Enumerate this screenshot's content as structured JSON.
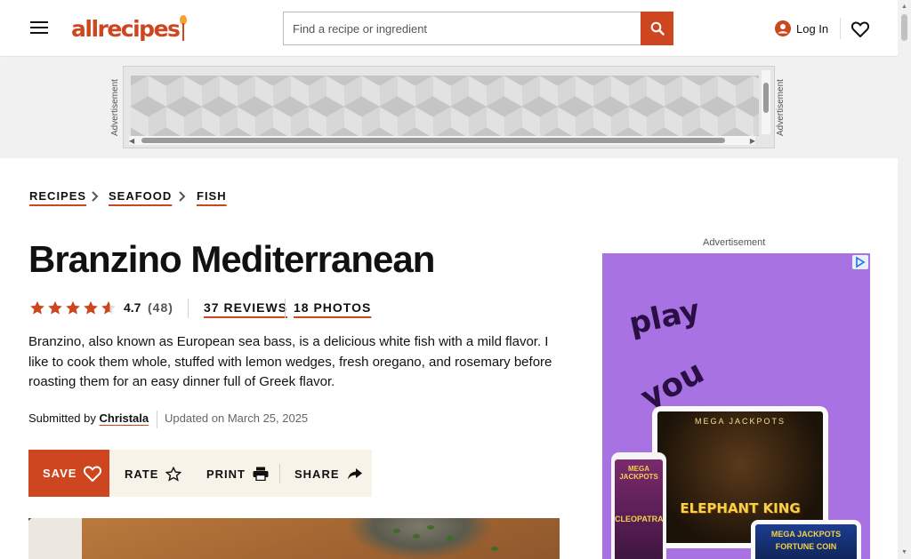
{
  "header": {
    "logo_text": "allrecipes",
    "search_placeholder": "Find a recipe or ingredient",
    "login_label": "Log In",
    "brand_color": "#ce4620"
  },
  "ad_band": {
    "label_left": "Advertisement",
    "label_right": "Advertisement"
  },
  "breadcrumbs": [
    "RECIPES",
    "SEAFOOD",
    "FISH"
  ],
  "recipe": {
    "title": "Branzino Mediterranean",
    "rating_value": "4.7",
    "rating_count": "(48)",
    "reviews_label": "37 REVIEWS",
    "photos_label": "18 PHOTOS",
    "description": "Branzino, also known as European sea bass, is a delicious white fish with a mild flavor. I like to cook them whole, stuffed with lemon wedges, fresh oregano, and rosemary before roasting them for an easy dinner full of Greek flavor.",
    "submitted_by_prefix": "Submitted by",
    "author": "Christala",
    "updated": "Updated on March 25, 2025"
  },
  "actions": {
    "save": "SAVE",
    "rate": "RATE",
    "print": "PRINT",
    "share": "SHARE"
  },
  "side_ad": {
    "label": "Advertisement",
    "word1": "play",
    "word2": "you",
    "brand_top": "MEGA JACKPOTS",
    "game_title": "ELEPHANT KING",
    "phone_brand": "MEGA JACKPOTS",
    "phone_game": "CLEOPATRA",
    "tablet2_brand": "MEGA JACKPOTS",
    "tablet2_game": "FORTUNE COIN"
  }
}
